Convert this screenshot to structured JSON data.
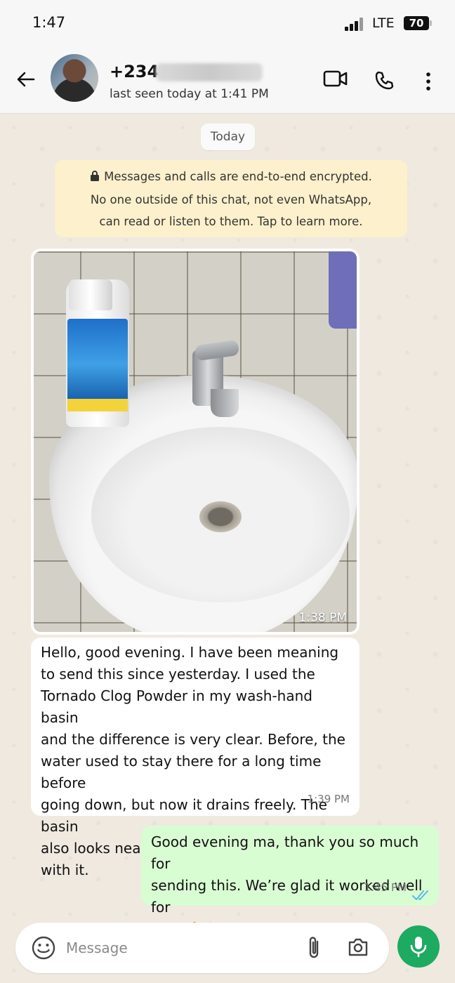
{
  "status_bar": {
    "time": "1:47",
    "network": "LTE",
    "battery": "70"
  },
  "header": {
    "contact_name": "+234",
    "last_seen": "last seen today at 1:41 PM"
  },
  "chat": {
    "date_chip": "Today",
    "encryption_notice": {
      "line1": "Messages and calls are end-to-end encrypted.",
      "line2": "No one outside of this chat, not even WhatsApp,",
      "line3": "can read or listen to them. Tap to learn more."
    },
    "image_message": {
      "time": "1:38 PM"
    },
    "messages": [
      {
        "direction": "incoming",
        "text": "Hello, good evening. I have been meaning\nto send this since yesterday. I used the\nTornado Clog Powder in my wash-hand basin\nand the difference is very clear. Before, the\nwater used to stay there for a long time before\ngoing down, but now it drains freely. The basin\nalso looks neater now. I’m really satisfied with it.",
        "time": "1:39 PM"
      },
      {
        "direction": "outgoing",
        "text": "Good evening ma, thank you so much for\nsending this. We’re glad it worked well for\nyou. 🙏😊",
        "time": "1:45 PM",
        "status": "read"
      }
    ]
  },
  "composer": {
    "placeholder": "Message"
  },
  "colors": {
    "accent": "#1daa61",
    "outgoing_bubble": "#d9fdd3",
    "encryption_bg": "#fdf0cc",
    "read_ticks": "#53bdeb"
  }
}
